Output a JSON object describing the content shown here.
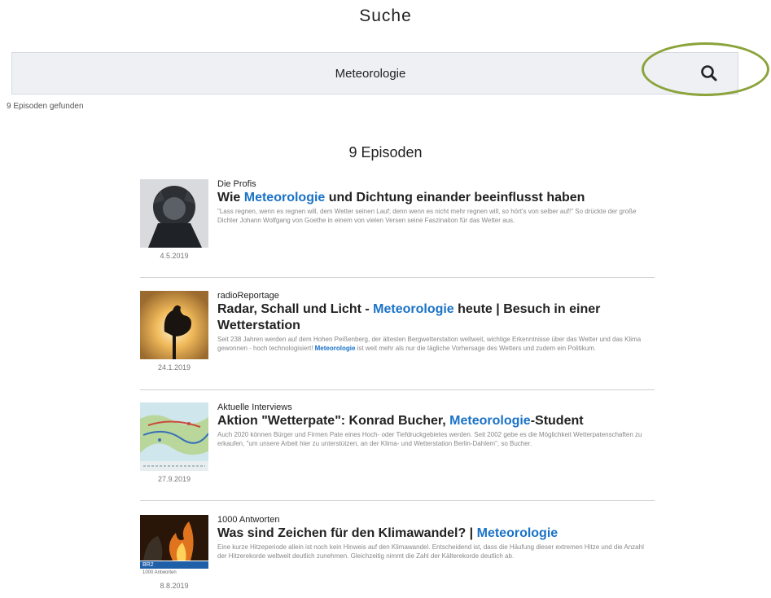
{
  "page": {
    "title": "Suche"
  },
  "search": {
    "query": "Meteorologie",
    "found_label": "9 Episoden gefunden"
  },
  "results": {
    "heading": "9 Episoden"
  },
  "episodes": [
    {
      "show": "Die Profis",
      "title_pre": "Wie ",
      "title_kw": "Meteorologie",
      "title_post": " und Dichtung einander beeinflusst haben",
      "desc_pre": "\"Lass regnen, wenn es regnen will, dem Wetter seinen Lauf; denn wenn es nicht mehr regnen will, so hört's von selber auf!\" So drückte der große Dichter Johann Wolfgang von Goethe in einem von vielen Versen seine Faszination für das Wetter aus.",
      "desc_kw": "",
      "desc_post": "",
      "date": "4.5.2019"
    },
    {
      "show": "radioReportage",
      "title_pre": "Radar, Schall und Licht - ",
      "title_kw": "Meteorologie",
      "title_post": " heute | Besuch in einer Wetterstation",
      "desc_pre": "Seit 238 Jahren werden auf dem Hohen Peißenberg, der ältesten Bergwetterstation weltweit, wichtige Erkenntnisse über das Wetter und das Klima gewonnen - hoch technologisiert! ",
      "desc_kw": "Meteorologie",
      "desc_post": " ist weit mehr als nur die tägliche Vorhersage des Wetters und zudem ein Politikum.",
      "date": "24.1.2019"
    },
    {
      "show": "Aktuelle Interviews",
      "title_pre": "Aktion \"Wetterpate\": Konrad Bucher, ",
      "title_kw": "Meteorologie",
      "title_post": "-Student",
      "desc_pre": "Auch 2020 können Bürger und Firmen Pate eines Hoch- oder Tiefdruckgebietes werden. Seit 2002 gebe es die Möglichkeit Wetterpatenschaften zu erkaufen, \"um unsere Arbeit hier zu unterstützen, an der Klima- und Wetterstation Berlin-Dahlem\", so Bucher.",
      "desc_kw": "",
      "desc_post": "",
      "date": "27.9.2019"
    },
    {
      "show": "1000 Antworten",
      "title_pre": "Was sind Zeichen für den Klimawandel? | ",
      "title_kw": "Meteorologie",
      "title_post": "",
      "desc_pre": "Eine kurze Hitzeperiode allein ist noch kein Hinweis auf den Klimawandel. Entscheidend ist, dass die Häufung dieser extremen Hitze und die Anzahl der Hitzerekorde weltweit deutlich zunehmen. Gleichzeitig nimmt die Zahl der Kälterekorde deutlich ab.",
      "desc_kw": "",
      "desc_post": "",
      "date": "8.8.2019",
      "thumb_badge": "BR2",
      "thumb_caption": "1000 Antworten"
    }
  ]
}
